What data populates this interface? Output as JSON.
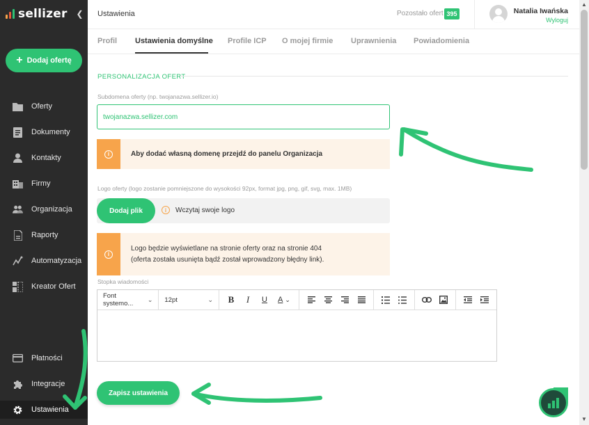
{
  "app": {
    "brand": "sellizer",
    "colors": {
      "accent": "#2fc374",
      "sidebar": "#2b2b2b",
      "warning": "#f7a44b",
      "warning_bg": "#fdf3e8",
      "annotation": "#2fc374"
    }
  },
  "sidebar": {
    "collapse_icon": "chevron-left-icon",
    "add_offer_label": "Dodaj ofertę",
    "items": [
      {
        "label": "Oferty",
        "icon": "folder-icon"
      },
      {
        "label": "Dokumenty",
        "icon": "document-icon"
      },
      {
        "label": "Kontakty",
        "icon": "user-icon"
      },
      {
        "label": "Firmy",
        "icon": "building-icon"
      },
      {
        "label": "Organizacja",
        "icon": "users-icon"
      },
      {
        "label": "Raporty",
        "icon": "report-icon"
      },
      {
        "label": "Automatyzacja",
        "icon": "automation-icon"
      },
      {
        "label": "Kreator Ofert",
        "icon": "builder-icon"
      }
    ],
    "bottom_items": [
      {
        "label": "Płatności",
        "icon": "credit-card-icon"
      },
      {
        "label": "Integracje",
        "icon": "puzzle-icon"
      },
      {
        "label": "Ustawienia",
        "icon": "gear-icon",
        "active": true
      }
    ]
  },
  "header": {
    "title": "Ustawienia",
    "offers_left_label": "Pozostało ofert",
    "offers_left_count": "395",
    "user_name": "Natalia Iwańska",
    "logout_label": "Wyloguj"
  },
  "tabs": [
    {
      "label": "Profil"
    },
    {
      "label": "Ustawienia domyślne",
      "active": true
    },
    {
      "label": "Profile ICP"
    },
    {
      "label": "O mojej firmie"
    },
    {
      "label": "Uprawnienia"
    },
    {
      "label": "Powiadomienia"
    }
  ],
  "form": {
    "section_title": "PERSONALIZACJA OFERT",
    "subdomain_label": "Subdomena oferty (np. twojanazwa.sellizer.io)",
    "subdomain_value": "twojanazwa.sellizer.com",
    "domain_alert": "Aby dodać własną domenę przejdź do panelu Organizacja",
    "logo_label": "Logo oferty (logo zostanie pomniejszone do wysokości 92px, format jpg, png, gif, svg, max. 1MB)",
    "upload_button": "Dodaj plik",
    "upload_hint": "Wczytaj swoje logo",
    "logo_alert_line1": "Logo będzie wyświetlane na stronie oferty oraz na stronie 404",
    "logo_alert_line2": "(oferta została usunięta bądź został wprowadzony błędny link).",
    "footer_label": "Stopka wiadomości",
    "editor": {
      "font_family": "Font systemo...",
      "font_size": "12pt",
      "bold": "B",
      "italic": "I",
      "underline": "U",
      "text_color": "A"
    },
    "save_button": "Zapisz ustawienia"
  }
}
